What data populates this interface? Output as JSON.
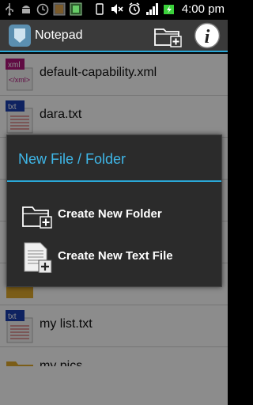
{
  "status_bar": {
    "time": "4:00 pm",
    "icons": [
      "usb-icon",
      "android-icon",
      "clock-icon",
      "app-notification-icon",
      "sd-card-icon",
      "mute-icon",
      "alarm-icon",
      "signal-icon",
      "battery-charging-icon"
    ]
  },
  "action_bar": {
    "title": "Notepad",
    "icons": [
      "notepad-app-icon",
      "new-folder-icon",
      "info-icon"
    ]
  },
  "files": [
    {
      "name": "default-capability.xml",
      "type": "xml"
    },
    {
      "name": "dara.txt",
      "type": "txt"
    },
    {
      "name": "",
      "type": "hidden"
    },
    {
      "name": "",
      "type": "hidden"
    },
    {
      "name": "",
      "type": "hidden"
    },
    {
      "name": "",
      "type": "folder"
    },
    {
      "name": "my list.txt",
      "type": "txt"
    },
    {
      "name": "my pics",
      "type": "folder"
    }
  ],
  "file_type_labels": {
    "xml": "xml",
    "xml_sub": "</xml>",
    "txt": "txt"
  },
  "dialog": {
    "title": "New File / Folder",
    "items": [
      {
        "label": "Create New Folder",
        "icon": "add-folder-icon"
      },
      {
        "label": "Create New Text File",
        "icon": "add-text-file-icon"
      }
    ]
  },
  "colors": {
    "accent": "#2aa8d8",
    "dialog_title": "#3fb7e8",
    "action_bar": "#3a3a3a",
    "dialog_bg": "#2b2b2b"
  }
}
